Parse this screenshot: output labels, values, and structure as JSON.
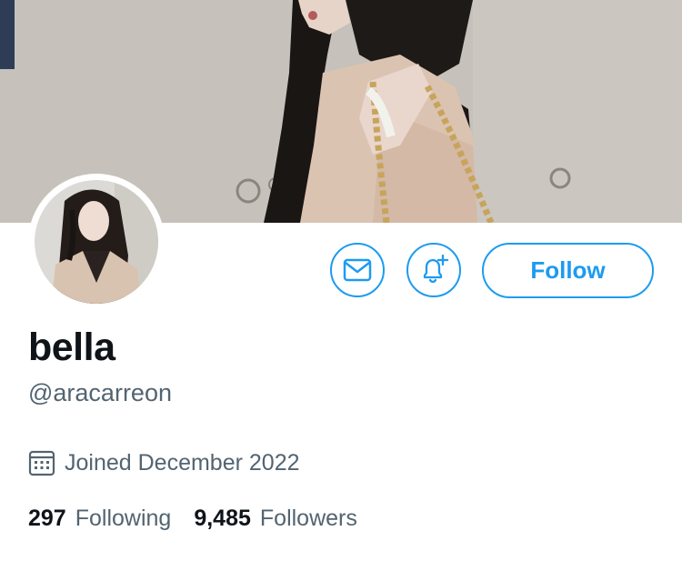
{
  "profile": {
    "display_name": "bella",
    "handle": "@aracarreon",
    "joined": "Joined December 2022",
    "banner_image": "banner-photo",
    "avatar_image": "profile-photo"
  },
  "stats": {
    "following_count": "297",
    "following_label": "Following",
    "followers_count": "9,485",
    "followers_label": "Followers"
  },
  "actions": {
    "message_icon": "envelope-icon",
    "notify_icon": "bell-plus-icon",
    "follow_label": "Follow"
  },
  "colors": {
    "accent": "#1d9bf0",
    "text_primary": "#0f1419",
    "text_secondary": "#536471",
    "background": "#ffffff"
  }
}
